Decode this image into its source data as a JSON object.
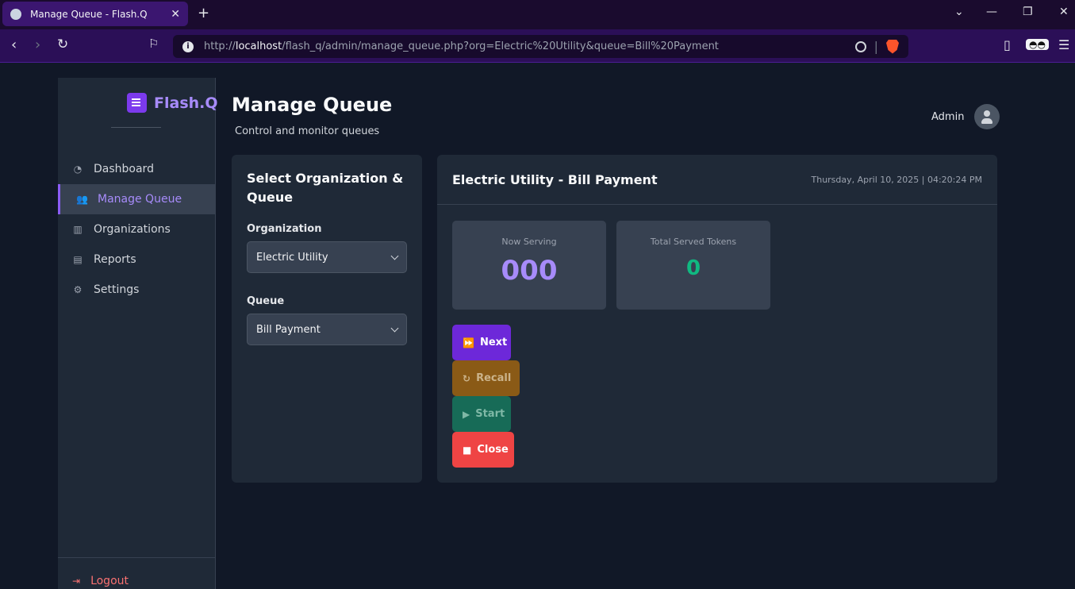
{
  "browser": {
    "tab_title": "Manage Queue - Flash.Q",
    "url_prefix": "http://",
    "url_host": "localhost",
    "url_path": "/flash_q/admin/manage_queue.php?org=Electric%20Utility&queue=Bill%20Payment"
  },
  "sidebar": {
    "brand": "Flash.Q",
    "items": [
      {
        "label": "Dashboard",
        "icon": "dashboard-icon"
      },
      {
        "label": "Manage Queue",
        "icon": "users-icon",
        "active": true
      },
      {
        "label": "Organizations",
        "icon": "building-icon"
      },
      {
        "label": "Reports",
        "icon": "chart-icon"
      },
      {
        "label": "Settings",
        "icon": "gear-icon"
      }
    ],
    "logout": "Logout"
  },
  "header": {
    "title": "Manage Queue",
    "subtitle": "Control and monitor queues",
    "user": "Admin"
  },
  "selector": {
    "heading": "Select Organization & Queue",
    "org_label": "Organization",
    "org_value": "Electric Utility",
    "queue_label": "Queue",
    "queue_value": "Bill Payment"
  },
  "queue_panel": {
    "title": "Electric Utility - Bill Payment",
    "datetime": "Thursday, April 10, 2025 | 04:20:24 PM",
    "now_serving_label": "Now Serving",
    "now_serving_value": "000",
    "total_served_label": "Total Served Tokens",
    "total_served_value": "0",
    "buttons": {
      "next": "Next",
      "recall": "Recall",
      "start": "Start",
      "close": "Close"
    }
  },
  "colors": {
    "accent": "#7c3aed",
    "success": "#10b981",
    "danger": "#ef4444",
    "warning": "#8a5a16"
  }
}
